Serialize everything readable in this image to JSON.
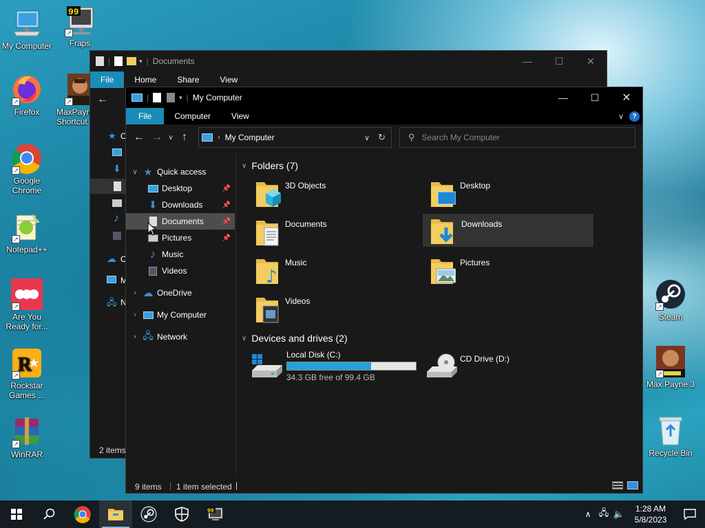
{
  "desktop": {
    "icons": [
      {
        "label": "My Computer"
      },
      {
        "label": "Fraps"
      },
      {
        "label": "Firefox"
      },
      {
        "label": "MaxPayne Shortcut"
      },
      {
        "label": "Google Chrome"
      },
      {
        "label": "Notepad++"
      },
      {
        "label": "Are You Ready for..."
      },
      {
        "label": "Rockstar Games ..."
      },
      {
        "label": "WinRAR"
      },
      {
        "label": "Steam"
      },
      {
        "label": "Max Payne 3"
      },
      {
        "label": "Recycle Bin"
      }
    ],
    "fraps_badge": "99"
  },
  "back_window": {
    "title": "Documents",
    "tabs": [
      "File",
      "Home",
      "Share",
      "View"
    ],
    "status": "2 items",
    "sidebar_letters": [
      "C",
      "O",
      "M",
      "N"
    ]
  },
  "front_window": {
    "title": "My Computer",
    "tabs": [
      "File",
      "Computer",
      "View"
    ],
    "address": "My Computer",
    "search_placeholder": "Search My Computer",
    "nav_tree": {
      "quick_access": "Quick access",
      "quick_items": [
        {
          "label": "Desktop"
        },
        {
          "label": "Downloads"
        },
        {
          "label": "Documents"
        },
        {
          "label": "Pictures"
        },
        {
          "label": "Music"
        },
        {
          "label": "Videos"
        }
      ],
      "onedrive": "OneDrive",
      "my_computer": "My Computer",
      "network": "Network"
    },
    "folders_header": "Folders (7)",
    "folders": [
      {
        "label": "3D Objects"
      },
      {
        "label": "Desktop"
      },
      {
        "label": "Documents"
      },
      {
        "label": "Downloads"
      },
      {
        "label": "Music"
      },
      {
        "label": "Pictures"
      },
      {
        "label": "Videos"
      }
    ],
    "drives_header": "Devices and drives (2)",
    "drives": [
      {
        "label": "Local Disk (C:)",
        "free": "34.3 GB free of 99.4 GB",
        "used_fraction": 0.655
      },
      {
        "label": "CD Drive (D:)"
      }
    ],
    "status_items": "9 items",
    "status_selected": "1 item selected"
  },
  "taskbar": {
    "time": "1:28 AM",
    "date": "5/8/2023",
    "fraps_badge": "99"
  },
  "colors": {
    "accent": "#1b8bb8",
    "explorer_bg": "#191919",
    "progress": "#26a0da",
    "folder": "#f3cd60"
  }
}
